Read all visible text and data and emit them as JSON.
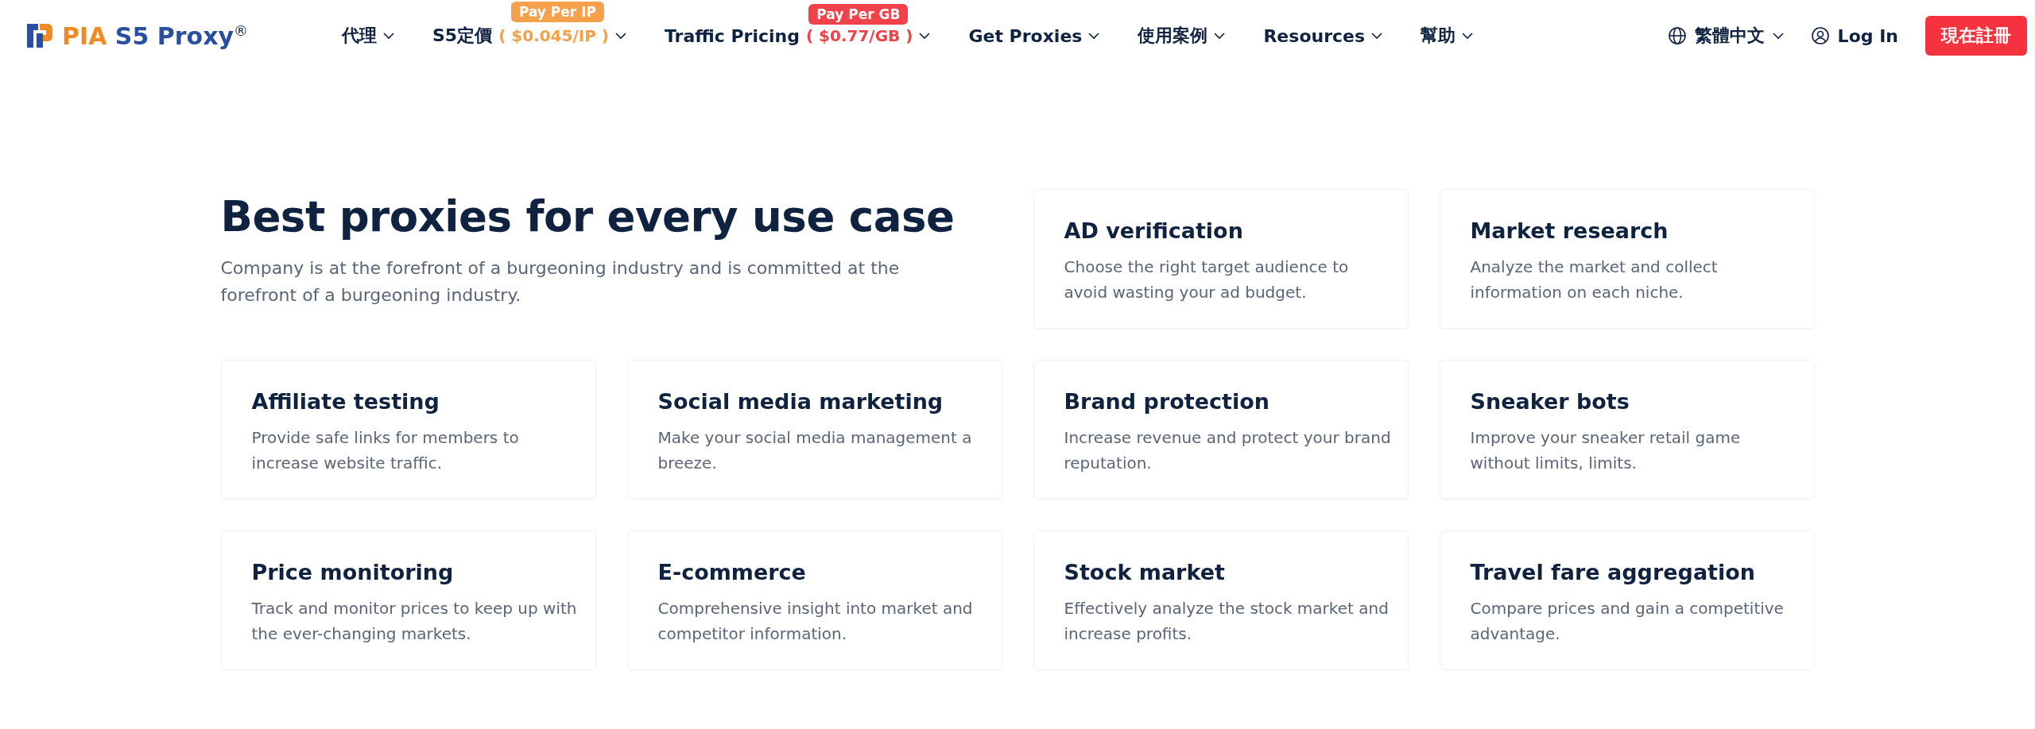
{
  "header": {
    "logo": {
      "brand": "PIA",
      "name": "S5 Proxy",
      "mark": "®"
    },
    "nav": [
      {
        "label": "代理"
      },
      {
        "label": "S5定價",
        "badge": {
          "label": "Pay Per IP",
          "price": "( $0.045/IP )",
          "color": "#f5a04a"
        }
      },
      {
        "label": "Traffic Pricing",
        "badge": {
          "label": "Pay Per GB",
          "price": "( $0.77/GB )",
          "color": "#f0424a"
        }
      },
      {
        "label": "Get Proxies"
      },
      {
        "label": "使用案例"
      },
      {
        "label": "Resources"
      },
      {
        "label": "幫助"
      }
    ],
    "language": "繁體中文",
    "login": "Log In",
    "signup": "現在註冊"
  },
  "intro": {
    "title": "Best proxies for every use case",
    "text": "Company is at the forefront of a burgeoning industry and is committed at the forefront of a burgeoning industry."
  },
  "cards": [
    {
      "title": "AD verification",
      "text": "Choose the right target audience to avoid wasting your ad budget."
    },
    {
      "title": "Market research",
      "text": "Analyze the market and collect information on each niche."
    },
    {
      "title": "Affiliate testing",
      "text": "Provide safe links for members to increase website traffic."
    },
    {
      "title": "Social media marketing",
      "text": "Make your social media management a breeze."
    },
    {
      "title": "Brand protection",
      "text": "Increase revenue and protect your brand reputation."
    },
    {
      "title": "Sneaker bots",
      "text": "Improve your sneaker retail game without limits, limits."
    },
    {
      "title": "Price monitoring",
      "text": "Track and monitor prices to keep up with the ever-changing markets."
    },
    {
      "title": "E-commerce",
      "text": "Comprehensive insight into market and competitor information."
    },
    {
      "title": "Stock market",
      "text": "Effectively analyze the stock market and increase profits."
    },
    {
      "title": "Travel fare aggregation",
      "text": "Compare prices and gain a competitive advantage."
    }
  ]
}
